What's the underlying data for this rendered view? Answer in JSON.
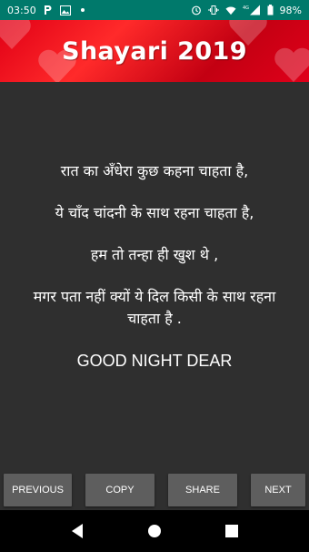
{
  "status_bar": {
    "time": "03:50",
    "left_icons": [
      "p-notification-icon",
      "image-icon",
      "dot-icon"
    ],
    "right_icons": [
      "alarm-icon",
      "vibrate-icon",
      "wifi-icon",
      "signal-icon",
      "battery-icon"
    ],
    "network": "4G",
    "battery_percent": "98%"
  },
  "header": {
    "title": "Shayari 2019",
    "accent_color": "#e10016"
  },
  "shayari": {
    "lines": [
      "रात का अँधेरा कुछ कहना चाहता है,",
      "ये चाँद चांदनी के साथ रहना चाहता है,",
      "हम तो तन्हा ही खुश थे ,",
      "मगर पता नहीं क्यों ये दिल किसी के साथ रहना चाहता है ."
    ],
    "closing": "GOOD NIGHT DEAR"
  },
  "buttons": {
    "previous": "PREVIOUS",
    "copy": "COPY",
    "share": "SHARE",
    "next": "NEXT"
  },
  "nav_bar": {
    "icons": [
      "back-icon",
      "home-icon",
      "recent-apps-icon"
    ]
  }
}
